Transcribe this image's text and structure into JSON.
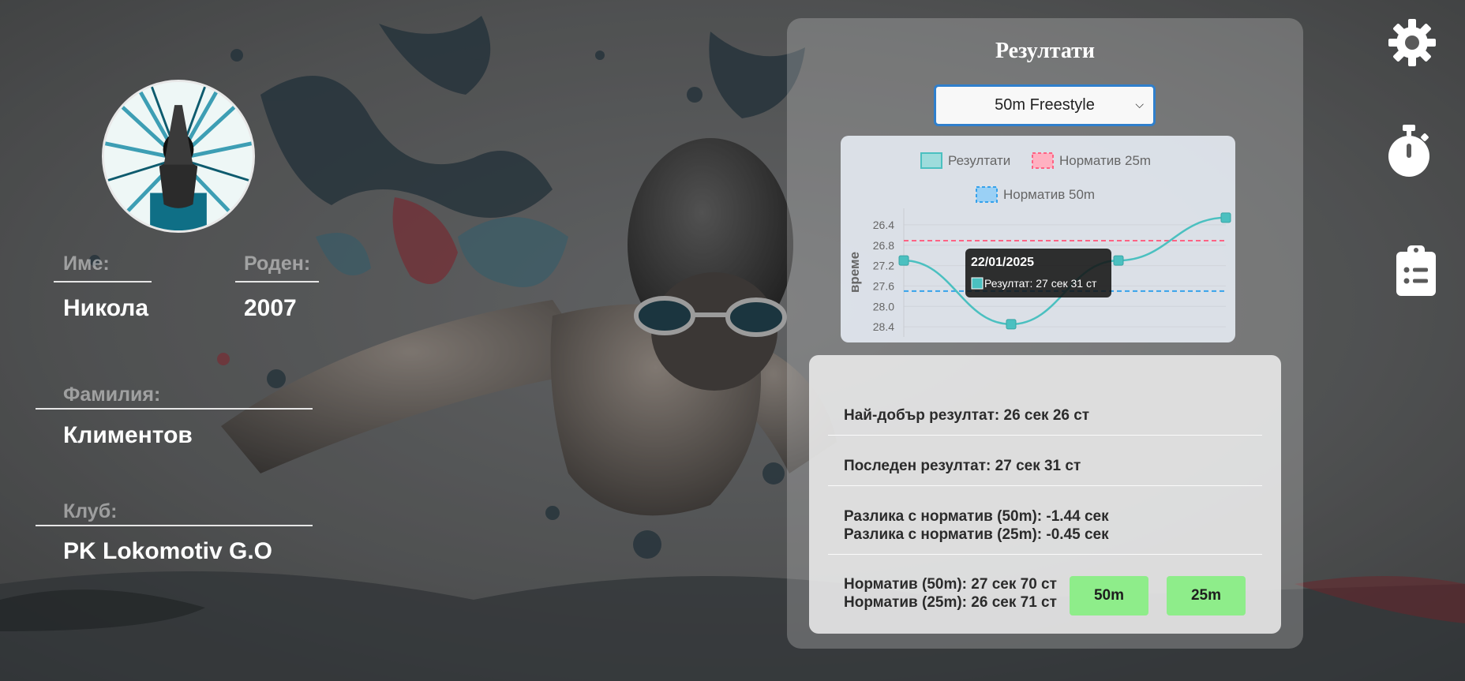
{
  "profile": {
    "first_name_label": "Име:",
    "first_name": "Никола",
    "born_label": "Роден:",
    "born": "2007",
    "last_name_label": "Фамилия:",
    "last_name": "Климентов",
    "club_label": "Клуб:",
    "club": "PK Lokomotiv G.O"
  },
  "results": {
    "title": "Резултати",
    "event_selected": "50m Freestyle"
  },
  "chart_data": {
    "type": "line",
    "ylabel": "време",
    "y_reversed": true,
    "ylim": [
      26.2,
      28.6
    ],
    "y_ticks": [
      "26.4",
      "26.8",
      "27.2",
      "27.6",
      "28.0",
      "28.4"
    ],
    "legend_position": "top",
    "series": [
      {
        "name": "Резултати",
        "color": "#4bc0c0",
        "values": [
          27.1,
          28.35,
          27.1,
          26.26
        ]
      }
    ],
    "reference_lines": [
      {
        "name": "Норматив 25m",
        "value": 26.71,
        "color": "#ff6384"
      },
      {
        "name": "Норматив 50m",
        "value": 27.7,
        "color": "#36a2eb"
      }
    ],
    "tooltip": {
      "title": "22/01/2025",
      "label": "Резултат: 27 сек 31 ст"
    }
  },
  "stats": {
    "best": "Най-добър резултат: 26 сек 26 ст",
    "last": "Последен резултат: 27 сек 31 ст",
    "diff_50": "Разлика с норматив (50m): -1.44 сек",
    "diff_25": "Разлика с норматив (25m): -0.45 сек",
    "norm_50": "Норматив (50m): 27 сек 70 ст",
    "norm_25": "Норматив (25m): 26 сек 71 ст",
    "btn_50": "50m",
    "btn_25": "25m"
  },
  "sidebar": {
    "icons": [
      "gear-icon",
      "stopwatch-icon",
      "clipboard-icon"
    ]
  }
}
